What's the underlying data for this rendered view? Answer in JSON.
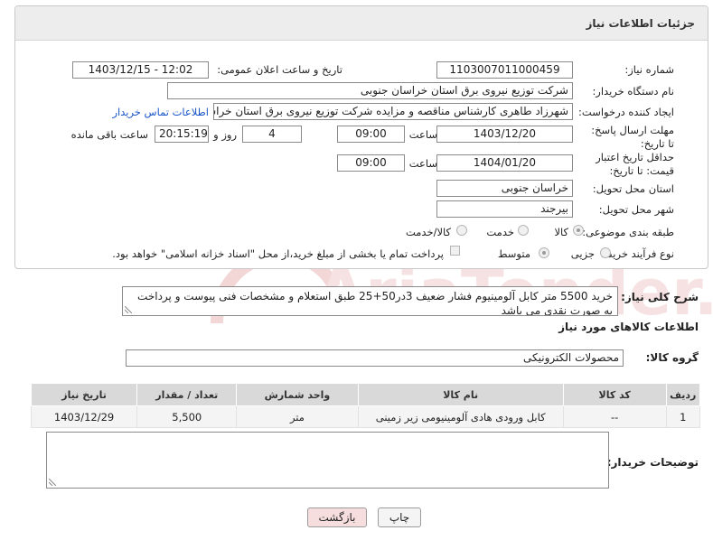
{
  "header": {
    "title": "جزئیات اطلاعات نیاز"
  },
  "form": {
    "need_number_label": "شماره نیاز:",
    "need_number": "1103007011000459",
    "announce_label": "تاریخ و ساعت اعلان عمومی:",
    "announce_value": "1403/12/15 - 12:02",
    "buyer_org_label": "نام دستگاه خریدار:",
    "buyer_org": "شرکت توزیع نیروی برق استان خراسان جنوبی",
    "creator_label": "ایجاد کننده درخواست:",
    "creator": "شهرزاد طاهری کارشناس مناقصه و مزایده شرکت توزیع نیروی برق استان خراسان جنوبی",
    "contact_link": "اطلاعات تماس خریدار",
    "reply_deadline_label": "مهلت ارسال پاسخ: تا تاریخ:",
    "reply_date": "1403/12/20",
    "time_label": "ساعت",
    "reply_time": "09:00",
    "days_value": "4",
    "days_label": "روز و",
    "remaining_value": "20:15:19",
    "remaining_label": "ساعت باقی مانده",
    "price_deadline_label": "حداقل تاریخ اعتبار قیمت: تا تاریخ:",
    "price_date": "1404/01/20",
    "price_time": "09:00",
    "province_label": "استان محل تحویل:",
    "province": "خراسان جنوبی",
    "city_label": "شهر محل تحویل:",
    "city": "بیرجند",
    "category_label": "طبقه بندی موضوعی:",
    "category_options": [
      "کالا",
      "خدمت",
      "کالا/خدمت"
    ],
    "process_label": "نوع فرآیند خرید :",
    "process_options": [
      "جزیی",
      "متوسط"
    ],
    "treasury_note": "پرداخت تمام یا بخشی از مبلغ خرید،از محل \"اسناد خزانه اسلامی\" خواهد بود."
  },
  "description": {
    "label": "شرح کلی نیاز:",
    "text": "خرید 5500 متر کابل آلومینیوم فشار ضعیف 3در50+25 طبق استعلام و مشخصات فنی پیوست و پرداخت به صورت نقدی می باشد"
  },
  "goods": {
    "section_title": "اطلاعات کالاهای مورد نیاز",
    "group_label": "گروه کالا:",
    "group_value": "محصولات الکترونیکی",
    "columns": [
      "ردیف",
      "کد کالا",
      "نام کالا",
      "واحد شمارش",
      "تعداد / مقدار",
      "تاریخ نیاز"
    ],
    "rows": [
      {
        "row": "1",
        "code": "--",
        "name": "کابل ورودی هادی آلومینیومی زیر زمینی",
        "unit": "متر",
        "qty": "5,500",
        "date": "1403/12/29"
      }
    ]
  },
  "buyer_notes": {
    "label": "توضیحات خریدار:",
    "text": ""
  },
  "buttons": {
    "print": "چاپ",
    "back": "بازگشت"
  },
  "colors": {
    "link": "#1a56c9",
    "back_button_bg": "#f7dede",
    "header_bg": "#ededed"
  }
}
